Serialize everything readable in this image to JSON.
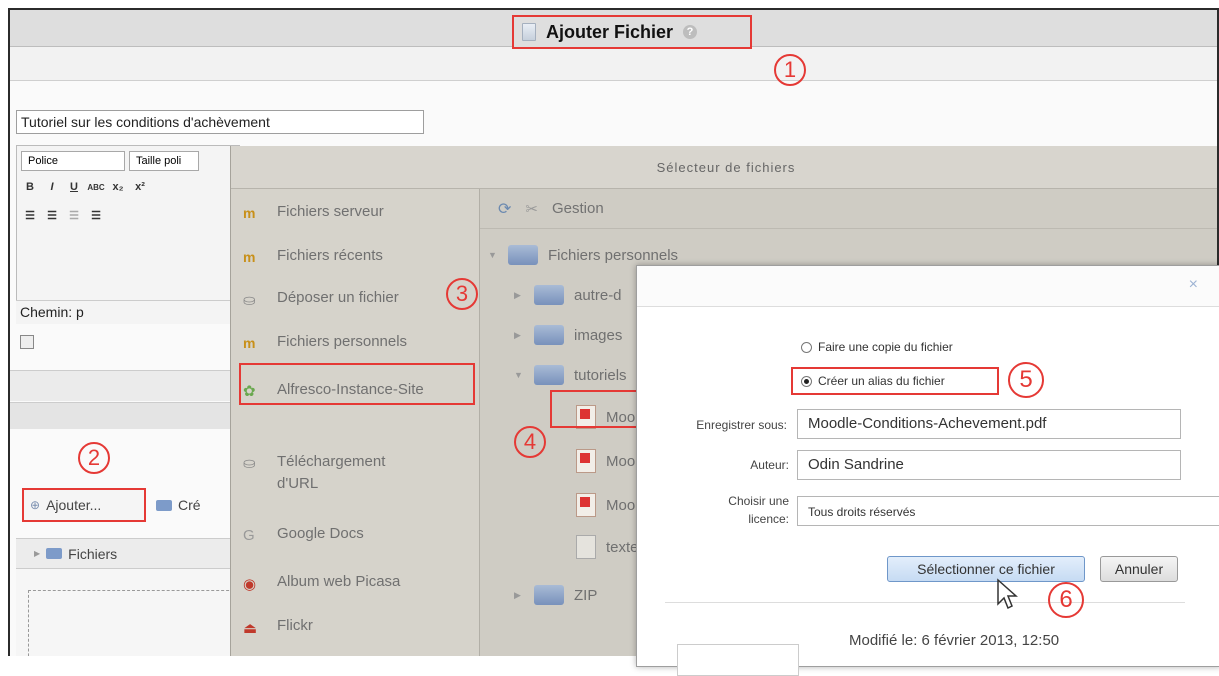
{
  "page": {
    "title": "Ajouter Fichier",
    "help_icon": "?",
    "resource_name": "Tutoriel sur les conditions d'achèvement"
  },
  "markers": [
    "1",
    "2",
    "3",
    "4",
    "5",
    "6"
  ],
  "editor": {
    "font_select": "Police",
    "size_select": "Taille poli",
    "buttons": [
      "B",
      "I",
      "U",
      "ABC",
      "x₂",
      "x²"
    ],
    "path_label": "Chemin: p"
  },
  "files_area": {
    "add_button": "Ajouter...",
    "create_button": "Cré",
    "tree_root": "Fichiers"
  },
  "picker": {
    "title": "Sélecteur de fichiers",
    "repositories": [
      {
        "label": "Fichiers serveur",
        "icon": "moodle-icon"
      },
      {
        "label": "Fichiers récents",
        "icon": "moodle-icon"
      },
      {
        "label": "Déposer un fichier",
        "icon": "upload-icon"
      },
      {
        "label": "Fichiers personnels",
        "icon": "moodle-icon"
      },
      {
        "label": "Alfresco-Instance-Site",
        "icon": "alfresco-icon"
      },
      {
        "label": "Téléchargement d'URL",
        "icon": "url-icon"
      },
      {
        "label": "Google Docs",
        "icon": "google-icon"
      },
      {
        "label": "Album web Picasa",
        "icon": "picasa-icon"
      },
      {
        "label": "Flickr",
        "icon": "flickr-icon"
      }
    ],
    "toolbar": {
      "manage_label": "Gestion"
    },
    "tree": {
      "root": "Fichiers personnels",
      "folders": [
        "autre-d",
        "images",
        "tutoriels",
        "ZIP"
      ],
      "files": [
        "Moo",
        "Moo",
        "Moo",
        "texte"
      ]
    }
  },
  "dialog": {
    "option_copy": "Faire une copie du fichier",
    "option_alias": "Créer un alias du fichier",
    "save_as_label": "Enregistrer sous:",
    "save_as_value": "Moodle-Conditions-Achevement.pdf",
    "author_label": "Auteur:",
    "author_value": "Odin Sandrine",
    "license_label": "Choisir une licence:",
    "license_value": "Tous droits réservés",
    "select_button": "Sélectionner ce fichier",
    "cancel_button": "Annuler",
    "modified": "Modifié le: 6 février 2013, 12:50",
    "close": "×"
  },
  "colors": {
    "highlight": "#e53935",
    "picker_bg": "#cfccc4"
  }
}
